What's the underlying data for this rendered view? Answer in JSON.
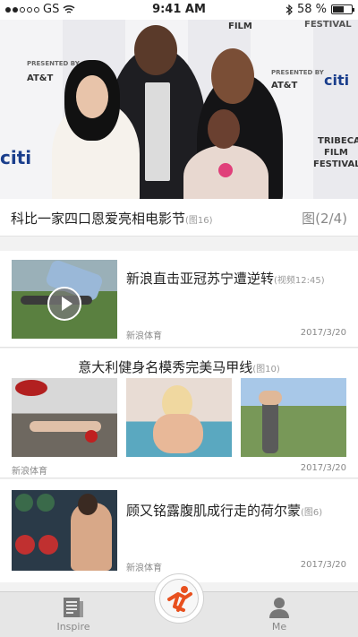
{
  "status": {
    "carrier": "GS",
    "time": "9:41 AM",
    "battery": "58 %"
  },
  "hero": {
    "logos": [
      "FILM",
      "FESTIVAL",
      "PRESENTED BY",
      "AT&T",
      "citi",
      "TRIBECA",
      "FILM",
      "FESTIVAL",
      "AT&T",
      "citi",
      "PRESENTED BY"
    ],
    "title": "科比一家四口恩爱亮相电影节",
    "title_tag": "(图16)",
    "page": "图(2/4)"
  },
  "news1": {
    "title": "新浪直击亚冠苏宁遭逆转",
    "tag": "(视频12:45)",
    "source": "新浪体育",
    "date": "2017/3/20"
  },
  "news2": {
    "title": "意大利健身名模秀完美马甲线",
    "tag": "(图10)",
    "source": "新浪体育",
    "date": "2017/3/20"
  },
  "news3": {
    "title": "顾又铭露腹肌成行走的荷尔蒙",
    "tag": "(图6)",
    "source": "新浪体育",
    "date": "2017/3/20"
  },
  "tabbar": {
    "left": "Inspire",
    "right": "Me",
    "left_icon": "newspaper-icon",
    "center_icon": "runner-logo-icon",
    "right_icon": "person-icon"
  },
  "colors": {
    "brand": "#e8501e",
    "accent_pink": "#e0407a"
  }
}
